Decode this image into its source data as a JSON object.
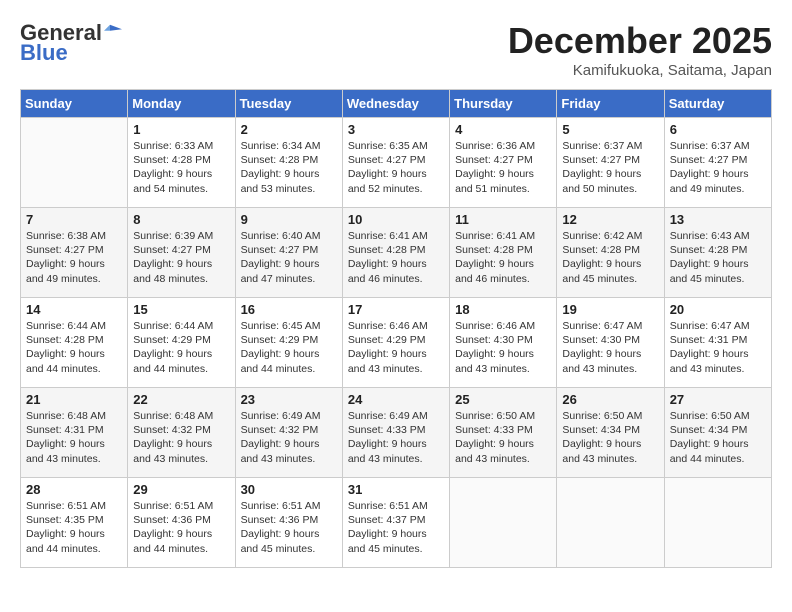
{
  "logo": {
    "line1": "General",
    "line2": "Blue"
  },
  "title": "December 2025",
  "location": "Kamifukuoka, Saitama, Japan",
  "weekdays": [
    "Sunday",
    "Monday",
    "Tuesday",
    "Wednesday",
    "Thursday",
    "Friday",
    "Saturday"
  ],
  "weeks": [
    [
      {
        "num": "",
        "info": ""
      },
      {
        "num": "1",
        "info": "Sunrise: 6:33 AM\nSunset: 4:28 PM\nDaylight: 9 hours\nand 54 minutes."
      },
      {
        "num": "2",
        "info": "Sunrise: 6:34 AM\nSunset: 4:28 PM\nDaylight: 9 hours\nand 53 minutes."
      },
      {
        "num": "3",
        "info": "Sunrise: 6:35 AM\nSunset: 4:27 PM\nDaylight: 9 hours\nand 52 minutes."
      },
      {
        "num": "4",
        "info": "Sunrise: 6:36 AM\nSunset: 4:27 PM\nDaylight: 9 hours\nand 51 minutes."
      },
      {
        "num": "5",
        "info": "Sunrise: 6:37 AM\nSunset: 4:27 PM\nDaylight: 9 hours\nand 50 minutes."
      },
      {
        "num": "6",
        "info": "Sunrise: 6:37 AM\nSunset: 4:27 PM\nDaylight: 9 hours\nand 49 minutes."
      }
    ],
    [
      {
        "num": "7",
        "info": "Sunrise: 6:38 AM\nSunset: 4:27 PM\nDaylight: 9 hours\nand 49 minutes."
      },
      {
        "num": "8",
        "info": "Sunrise: 6:39 AM\nSunset: 4:27 PM\nDaylight: 9 hours\nand 48 minutes."
      },
      {
        "num": "9",
        "info": "Sunrise: 6:40 AM\nSunset: 4:27 PM\nDaylight: 9 hours\nand 47 minutes."
      },
      {
        "num": "10",
        "info": "Sunrise: 6:41 AM\nSunset: 4:28 PM\nDaylight: 9 hours\nand 46 minutes."
      },
      {
        "num": "11",
        "info": "Sunrise: 6:41 AM\nSunset: 4:28 PM\nDaylight: 9 hours\nand 46 minutes."
      },
      {
        "num": "12",
        "info": "Sunrise: 6:42 AM\nSunset: 4:28 PM\nDaylight: 9 hours\nand 45 minutes."
      },
      {
        "num": "13",
        "info": "Sunrise: 6:43 AM\nSunset: 4:28 PM\nDaylight: 9 hours\nand 45 minutes."
      }
    ],
    [
      {
        "num": "14",
        "info": "Sunrise: 6:44 AM\nSunset: 4:28 PM\nDaylight: 9 hours\nand 44 minutes."
      },
      {
        "num": "15",
        "info": "Sunrise: 6:44 AM\nSunset: 4:29 PM\nDaylight: 9 hours\nand 44 minutes."
      },
      {
        "num": "16",
        "info": "Sunrise: 6:45 AM\nSunset: 4:29 PM\nDaylight: 9 hours\nand 44 minutes."
      },
      {
        "num": "17",
        "info": "Sunrise: 6:46 AM\nSunset: 4:29 PM\nDaylight: 9 hours\nand 43 minutes."
      },
      {
        "num": "18",
        "info": "Sunrise: 6:46 AM\nSunset: 4:30 PM\nDaylight: 9 hours\nand 43 minutes."
      },
      {
        "num": "19",
        "info": "Sunrise: 6:47 AM\nSunset: 4:30 PM\nDaylight: 9 hours\nand 43 minutes."
      },
      {
        "num": "20",
        "info": "Sunrise: 6:47 AM\nSunset: 4:31 PM\nDaylight: 9 hours\nand 43 minutes."
      }
    ],
    [
      {
        "num": "21",
        "info": "Sunrise: 6:48 AM\nSunset: 4:31 PM\nDaylight: 9 hours\nand 43 minutes."
      },
      {
        "num": "22",
        "info": "Sunrise: 6:48 AM\nSunset: 4:32 PM\nDaylight: 9 hours\nand 43 minutes."
      },
      {
        "num": "23",
        "info": "Sunrise: 6:49 AM\nSunset: 4:32 PM\nDaylight: 9 hours\nand 43 minutes."
      },
      {
        "num": "24",
        "info": "Sunrise: 6:49 AM\nSunset: 4:33 PM\nDaylight: 9 hours\nand 43 minutes."
      },
      {
        "num": "25",
        "info": "Sunrise: 6:50 AM\nSunset: 4:33 PM\nDaylight: 9 hours\nand 43 minutes."
      },
      {
        "num": "26",
        "info": "Sunrise: 6:50 AM\nSunset: 4:34 PM\nDaylight: 9 hours\nand 43 minutes."
      },
      {
        "num": "27",
        "info": "Sunrise: 6:50 AM\nSunset: 4:34 PM\nDaylight: 9 hours\nand 44 minutes."
      }
    ],
    [
      {
        "num": "28",
        "info": "Sunrise: 6:51 AM\nSunset: 4:35 PM\nDaylight: 9 hours\nand 44 minutes."
      },
      {
        "num": "29",
        "info": "Sunrise: 6:51 AM\nSunset: 4:36 PM\nDaylight: 9 hours\nand 44 minutes."
      },
      {
        "num": "30",
        "info": "Sunrise: 6:51 AM\nSunset: 4:36 PM\nDaylight: 9 hours\nand 45 minutes."
      },
      {
        "num": "31",
        "info": "Sunrise: 6:51 AM\nSunset: 4:37 PM\nDaylight: 9 hours\nand 45 minutes."
      },
      {
        "num": "",
        "info": ""
      },
      {
        "num": "",
        "info": ""
      },
      {
        "num": "",
        "info": ""
      }
    ]
  ]
}
